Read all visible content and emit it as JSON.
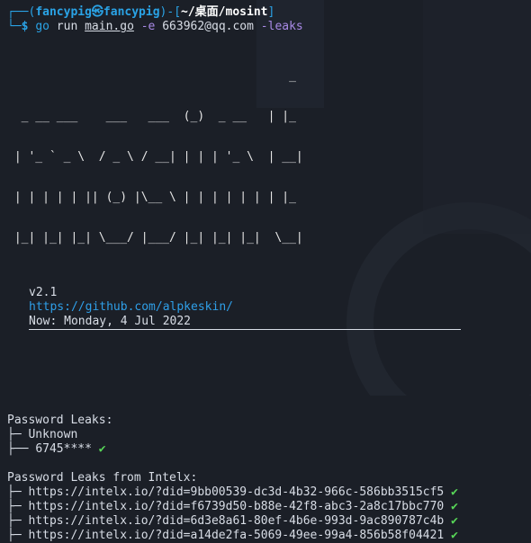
{
  "window": {
    "title": ""
  },
  "prompt": {
    "corner_top": "┌──(",
    "user_host": "fancypig㉿fancypig",
    "sep": ")-[",
    "path": "~/桌面/mosint",
    "close": "]",
    "corner_bottom": "└─",
    "dollar": "$",
    "command": "go",
    "arg_run": "run",
    "arg_file": "main.go",
    "flag_e": "-e",
    "email": "663962@qq.com",
    "flag_leaks": "-leaks"
  },
  "banner": {
    "ascii_lines": [
      "                                        _",
      "  _ __ ___    ___   ___  (_)  _ __   | |_",
      " | '_ ` _ \\  / _ \\ / __| | | | '_ \\  | __|",
      " | | | | | || (_) |\\__ \\ | | | | | | | |_",
      " |_| |_| |_| \\___/ |___/ |_| |_| |_|  \\__|"
    ],
    "version": "v2.1",
    "url": "https://github.com/alpkeskin/",
    "now": "Now: Monday, 4 Jul 2022"
  },
  "password_leaks": {
    "heading": "Password Leaks:",
    "items": [
      {
        "prefix": "├─ ",
        "text": "Unknown",
        "check": ""
      },
      {
        "prefix": "├── ",
        "text": "6745****",
        "check": "✔"
      }
    ]
  },
  "intelx": {
    "heading": "Password Leaks from Intelx:",
    "items": [
      {
        "prefix": "├─ ",
        "url": "https://intelx.io/?did=9bb00539-dc3d-4b32-966c-586bb3515cf5",
        "check": "✔"
      },
      {
        "prefix": "├─ ",
        "url": "https://intelx.io/?did=f6739d50-b88e-42f8-abc3-2a8c17bbc770",
        "check": "✔"
      },
      {
        "prefix": "├─ ",
        "url": "https://intelx.io/?did=6d3e8a61-80ef-4b6e-993d-9ac890787c4b",
        "check": "✔"
      },
      {
        "prefix": "├─ ",
        "url": "https://intelx.io/?did=a14de2fa-5069-49ee-99a4-856b58f04421",
        "check": "✔"
      }
    ]
  },
  "colors": {
    "background": "#1b1f27",
    "prompt_blue": "#2aa3e6",
    "purple": "#a88ae6",
    "link": "#2f9fe8",
    "check_green": "#57d657"
  }
}
